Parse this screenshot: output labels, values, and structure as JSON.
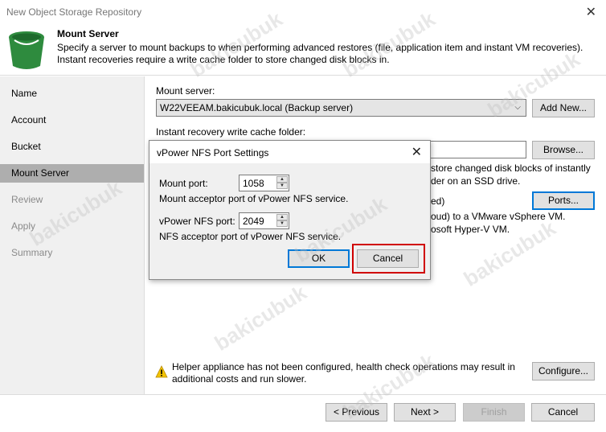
{
  "window": {
    "title": "New Object Storage Repository",
    "close_glyph": "✕"
  },
  "header": {
    "title": "Mount Server",
    "description": "Specify a server to mount backups to when performing advanced restores (file, application item and instant VM recoveries). Instant recoveries require a write cache folder to store changed disk blocks in."
  },
  "sidebar": {
    "steps": [
      {
        "label": "Name",
        "state": "done"
      },
      {
        "label": "Account",
        "state": "done"
      },
      {
        "label": "Bucket",
        "state": "done"
      },
      {
        "label": "Mount Server",
        "state": "active"
      },
      {
        "label": "Review",
        "state": "disabled"
      },
      {
        "label": "Apply",
        "state": "disabled"
      },
      {
        "label": "Summary",
        "state": "disabled"
      }
    ]
  },
  "main": {
    "mount_server_label": "Mount server:",
    "mount_server_value": "W22VEEAM.bakicubuk.local (Backup server)",
    "add_new_label": "Add New...",
    "cache_folder_label": "Instant recovery write cache folder:",
    "cache_folder_value": "",
    "browse_label": "Browse...",
    "cache_hint_line1": "store changed disk blocks of instantly",
    "cache_hint_line2": "der on an SSD drive.",
    "nfs_partial": "ed)",
    "ports_label": "Ports...",
    "vm_line1": "oud) to a VMware vSphere VM.",
    "vm_line2": "osoft Hyper-V VM.",
    "helper_text": "Helper appliance has not been configured, health check operations may result in additional costs and run slower.",
    "configure_label": "Configure..."
  },
  "footer": {
    "previous_label": "< Previous",
    "next_label": "Next >",
    "finish_label": "Finish",
    "cancel_label": "Cancel"
  },
  "dialog": {
    "title": "vPower NFS Port Settings",
    "close_glyph": "✕",
    "mount_port_label": "Mount port:",
    "mount_port_value": "1058",
    "mount_port_desc": "Mount acceptor port of vPower NFS service.",
    "nfs_port_label": "vPower NFS port:",
    "nfs_port_value": "2049",
    "nfs_port_desc": "NFS acceptor port of vPower NFS service.",
    "ok_label": "OK",
    "cancel_label": "Cancel"
  },
  "watermark": "bakicubuk",
  "colors": {
    "accent": "#0078d7",
    "highlight_box": "#d00000",
    "bucket_green": "#2e8b3e",
    "warning_yellow": "#f2c200"
  }
}
